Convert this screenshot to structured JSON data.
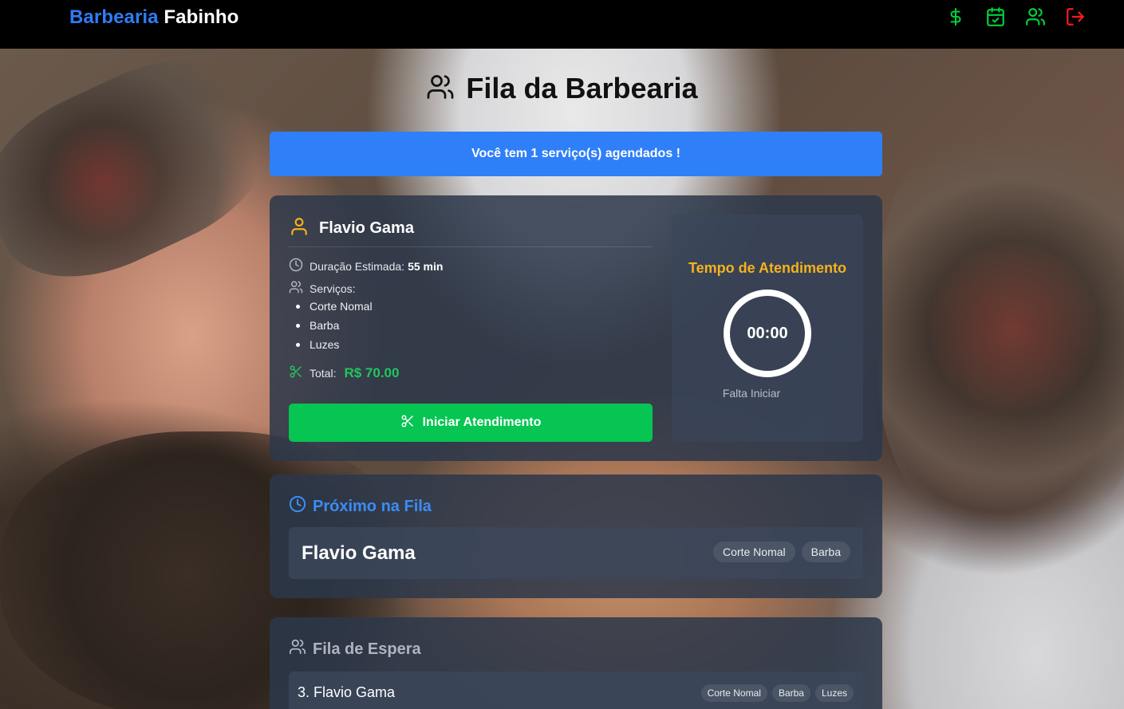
{
  "app": {
    "brand_part1": "Barbearia",
    "brand_part2": "Fabinho"
  },
  "nav": {
    "icons": [
      "dollar-icon",
      "calendar-check-icon",
      "users-icon",
      "logout-icon"
    ],
    "colors": {
      "primary": "#00d13a",
      "logout": "#ff1a1a"
    }
  },
  "page": {
    "title": "Fila da Barbearia",
    "banner": "Você tem 1 serviço(s) agendados !"
  },
  "current": {
    "client_name": "Flavio Gama",
    "duration_label": "Duração Estimada:",
    "duration_value": "55 min",
    "services_label": "Serviços:",
    "services": [
      "Corte Nomal",
      "Barba",
      "Luzes"
    ],
    "total_label": "Total:",
    "total_value": "R$ 70.00",
    "start_button": "Iniciar Atendimento",
    "timer_title": "Tempo de Atendimento",
    "timer_value": "00:00",
    "timer_status": "Falta Iniciar"
  },
  "next": {
    "title": "Próximo na Fila",
    "client_name": "Flavio Gama",
    "services": [
      "Corte Nomal",
      "Barba"
    ]
  },
  "waiting": {
    "title": "Fila de Espera",
    "items": [
      {
        "label": "3. Flavio Gama",
        "services": [
          "Corte Nomal",
          "Barba",
          "Luzes"
        ]
      }
    ]
  },
  "colors": {
    "accent_blue": "#2f7ff8",
    "success_green": "#06c552",
    "timer_orange": "#f5b21b"
  }
}
